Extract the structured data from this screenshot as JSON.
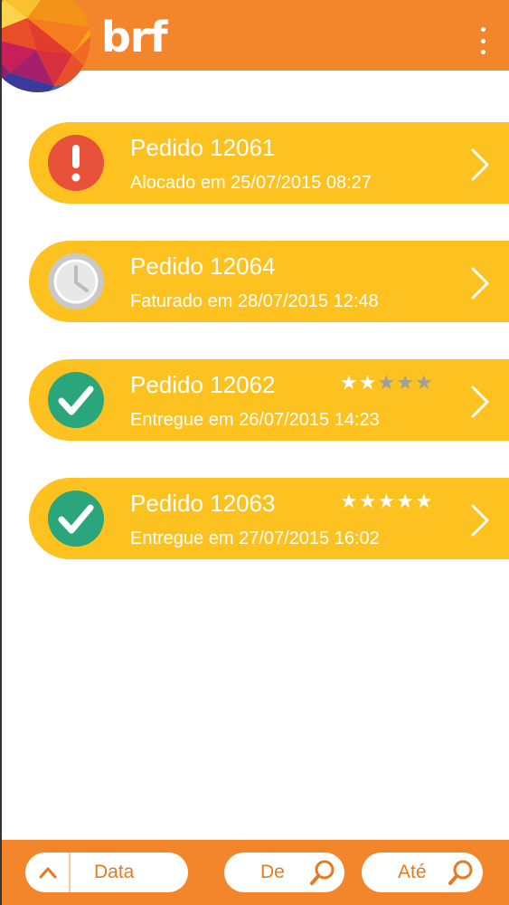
{
  "header": {
    "brand": "brf",
    "menu_icon": "more-vert-icon",
    "colors": {
      "bar": "#F3862A"
    }
  },
  "orders": [
    {
      "title": "Pedido 12061",
      "subtitle": "Alocado em 25/07/2015 08:27",
      "status": "alert",
      "status_icon": "exclamation-icon",
      "status_color": "#E8513A",
      "rating": null
    },
    {
      "title": "Pedido 12064",
      "subtitle": "Faturado em 28/07/2015 12:48",
      "status": "pending",
      "status_icon": "clock-icon",
      "status_color": "#C9C9C9",
      "rating": null
    },
    {
      "title": "Pedido 12062",
      "subtitle": "Entregue em 26/07/2015 14:23",
      "status": "delivered",
      "status_icon": "check-icon",
      "status_color": "#2BA57B",
      "rating": 2
    },
    {
      "title": "Pedido 12063",
      "subtitle": "Entregue em 27/07/2015 16:02",
      "status": "delivered",
      "status_icon": "check-icon",
      "status_color": "#2BA57B",
      "rating": 5
    }
  ],
  "filters": {
    "sort_label": "Data",
    "from_label": "De",
    "to_label": "Até"
  },
  "colors": {
    "card": "#FDC21F",
    "accent": "#F3862A",
    "pill_text": "#E67A1F"
  }
}
